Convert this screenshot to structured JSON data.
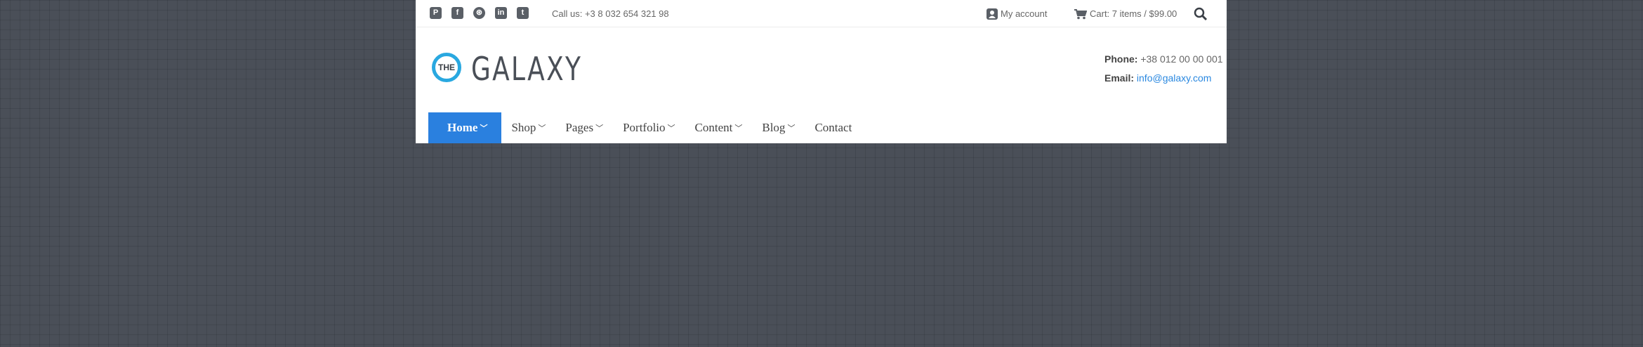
{
  "topbar": {
    "social": [
      {
        "icon": "pinterest-icon",
        "glyph": "P"
      },
      {
        "icon": "facebook-icon",
        "glyph": "f"
      },
      {
        "icon": "dribbble-icon",
        "glyph": "⊛"
      },
      {
        "icon": "linkedin-icon",
        "glyph": "in"
      },
      {
        "icon": "twitter-icon",
        "glyph": "t"
      }
    ],
    "call_us": "Call us: +3 8 032 654 321 98",
    "my_account": "My account",
    "cart": "Cart: 7 items / $99.00"
  },
  "header": {
    "logo_badge": "THE",
    "logo_text": "GALAXY",
    "phone_label": "Phone:",
    "phone_value": "+38 012 00 00 001",
    "email_label": "Email:",
    "email_value": "info@galaxy.com"
  },
  "nav": {
    "items": [
      {
        "label": "Home",
        "chevron": "﹀",
        "active": true
      },
      {
        "label": "Shop",
        "chevron": "﹀"
      },
      {
        "label": "Pages",
        "chevron": "﹀"
      },
      {
        "label": "Portfolio",
        "chevron": "﹀"
      },
      {
        "label": "Content",
        "chevron": "﹀"
      },
      {
        "label": "Blog",
        "chevron": "﹀"
      },
      {
        "label": "Contact",
        "chevron": ""
      }
    ]
  },
  "colors": {
    "accent": "#2a80df",
    "logo_ring": "#29a8e0",
    "background": "#4a4f58"
  }
}
